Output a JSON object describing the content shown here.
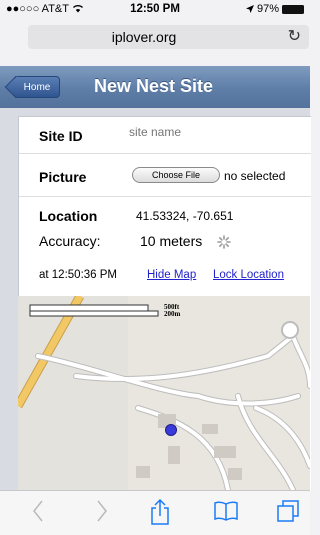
{
  "status": {
    "carrier": "●●○○○ AT&T",
    "time": "12:50 PM",
    "battery": "97%"
  },
  "browser": {
    "url": "iplover.org"
  },
  "header": {
    "back_label": "Home",
    "title": "New Nest Site"
  },
  "form": {
    "site_id_label": "Site ID",
    "site_id_placeholder": "site name",
    "picture_label": "Picture",
    "choose_button": "Choose File",
    "no_file": "no selected",
    "location_label": "Location",
    "location_value": "41.53324, -70.651",
    "accuracy_label": "Accuracy:",
    "accuracy_value": "10 meters",
    "time_text": "at 12:50:36 PM",
    "hide_map": "Hide Map",
    "lock_location": "Lock Location"
  },
  "map": {
    "scale_ft": "500ft",
    "scale_m": "200m"
  },
  "colors": {
    "navbar": "#5e7ea7",
    "link": "#2222cc",
    "marker": "#3a3adb",
    "road": "#e8b84a"
  },
  "icons": [
    "wifi-icon",
    "location-arrow-icon",
    "battery-icon",
    "reload-icon",
    "spinner-icon",
    "location-marker-icon",
    "back-icon",
    "forward-icon",
    "share-icon",
    "bookmarks-icon",
    "tabs-icon"
  ]
}
